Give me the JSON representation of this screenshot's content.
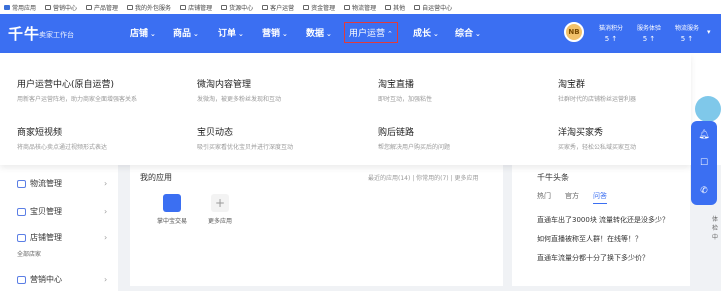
{
  "bookmarks": [
    {
      "label": "常用应用",
      "icon": "app-icon"
    },
    {
      "label": "营销中心",
      "icon": "folder-icon"
    },
    {
      "label": "产品管理",
      "icon": "folder-icon"
    },
    {
      "label": "我的外包服务",
      "icon": "folder-icon"
    },
    {
      "label": "店铺管理",
      "icon": "folder-icon"
    },
    {
      "label": "货源中心",
      "icon": "folder-icon"
    },
    {
      "label": "客户运营",
      "icon": "folder-icon"
    },
    {
      "label": "资金管理",
      "icon": "folder-icon"
    },
    {
      "label": "物流管理",
      "icon": "folder-icon"
    },
    {
      "label": "其他",
      "icon": "folder-icon"
    },
    {
      "label": "自运营中心",
      "icon": "folder-icon"
    }
  ],
  "header": {
    "logo": "千牛",
    "logo_sub": "卖家工作台",
    "nav": [
      {
        "label": "店铺",
        "active": false
      },
      {
        "label": "商品",
        "active": false
      },
      {
        "label": "订单",
        "active": false
      },
      {
        "label": "营销",
        "active": false
      },
      {
        "label": "数据",
        "active": false
      },
      {
        "label": "用户运营",
        "active": true
      },
      {
        "label": "成长",
        "active": false
      },
      {
        "label": "综合",
        "active": false
      }
    ],
    "avatar_text": "NB",
    "stats": [
      {
        "label": "猫消积分",
        "value": "5 ↑"
      },
      {
        "label": "服务体验",
        "value": "5 ↑"
      },
      {
        "label": "物流服务",
        "value": "5 ↑"
      }
    ]
  },
  "dropdown": {
    "items": [
      {
        "title": "用户运营中心(原自运营)",
        "desc": "用新客户运营阵地，助力商家全面增强客关系"
      },
      {
        "title": "微淘内容管理",
        "desc": "发微淘，被更多粉丝发现和互动"
      },
      {
        "title": "淘宝直播",
        "desc": "即时互动，加强粘性"
      },
      {
        "title": "淘宝群",
        "desc": "社群时代的店铺粉丝运营利器"
      },
      {
        "title": "商家短视频",
        "desc": "将商品核心卖点通过视频形式表达"
      },
      {
        "title": "宝贝动态",
        "desc": "吸引买家看优化宝贝并进行深度互动"
      },
      {
        "title": "购后链路",
        "desc": "帮您解决用户购买后的问题"
      },
      {
        "title": "洋淘买家秀",
        "desc": "买家秀，轻松公私域买家互动"
      }
    ]
  },
  "sidebar": {
    "items": [
      {
        "label": "物流管理",
        "icon": "truck-icon"
      },
      {
        "label": "宝贝管理",
        "icon": "box-icon"
      },
      {
        "label": "店铺管理",
        "icon": "store-icon",
        "sub": "全部店家"
      },
      {
        "label": "营销中心",
        "icon": "megaphone-icon"
      }
    ]
  },
  "apps": {
    "title": "我的应用",
    "links": "最近的应用(14) | 你常用的(7) | 更多应用",
    "tiles": [
      {
        "label": "掌中宝交易",
        "color": "#3b6ff2"
      },
      {
        "label": "更多应用",
        "color": "#f3f3f3"
      }
    ]
  },
  "headlines": {
    "title": "千牛头条",
    "tabs": [
      "热门",
      "官方",
      "问答"
    ],
    "active_tab": 2,
    "items": [
      "直通车出了3000块 流量转化还是没多少？",
      "如何直播被称至人群！在线等！？",
      "直通车流量分都十分了换下多少价？"
    ]
  },
  "float": {
    "buttons": [
      "bell-icon",
      "chat-icon",
      "phone-icon"
    ]
  },
  "right_edge_text": [
    "体",
    "检",
    "中"
  ]
}
